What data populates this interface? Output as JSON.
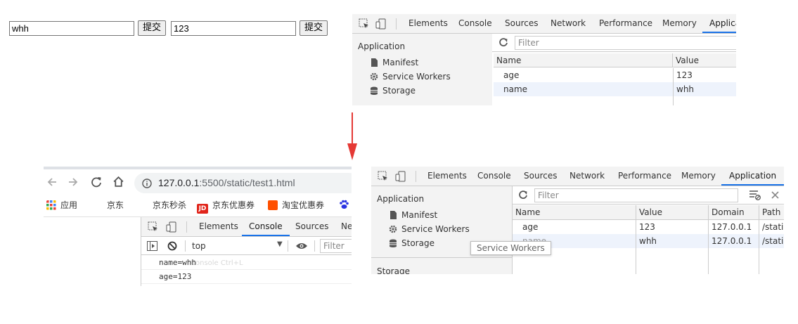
{
  "form": {
    "input1_value": "whh",
    "submit1_label": "提交",
    "input2_value": "123",
    "submit2_label": "提交"
  },
  "devtools_top": {
    "tabs": [
      "Elements",
      "Console",
      "Sources",
      "Network",
      "Performance",
      "Memory",
      "Applica"
    ],
    "active_tab": "Applica",
    "sidebar_title": "Application",
    "sidebar_items": [
      "Manifest",
      "Service Workers",
      "Storage"
    ],
    "filter_placeholder": "Filter",
    "columns": [
      "Name",
      "Value"
    ],
    "rows": [
      {
        "name": "age",
        "value": "123"
      },
      {
        "name": "name",
        "value": "whh"
      }
    ]
  },
  "browser": {
    "url_host": "127.0.0.1",
    "url_path": ":5500/static/test1.html",
    "bookmarks": [
      "应用",
      "京东",
      "京东秒杀",
      "京东优惠券",
      "淘宝优惠券"
    ],
    "devtools_tabs": [
      "Elements",
      "Console",
      "Sources",
      "Ne"
    ],
    "active_tab": "Console",
    "context": "top",
    "filter_placeholder": "Filter",
    "console_lines": [
      "name=whh",
      "age=123"
    ],
    "ghost_hint": "Console  Ctrl+L"
  },
  "devtools_bottom": {
    "tabs": [
      "Elements",
      "Console",
      "Sources",
      "Network",
      "Performance",
      "Memory",
      "Application"
    ],
    "active_tab": "Application",
    "sidebar_title": "Application",
    "sidebar_items": [
      "Manifest",
      "Service Workers",
      "Storage"
    ],
    "sidebar_section2": "Storage",
    "filter_placeholder": "Filter",
    "columns": [
      "Name",
      "Value",
      "Domain",
      "Path"
    ],
    "rows": [
      {
        "name": "age",
        "value": "123",
        "domain": "127.0.0.1",
        "path": "/static"
      },
      {
        "name": "name",
        "value": "whh",
        "domain": "127.0.0.1",
        "path": "/static"
      }
    ],
    "tooltip": "Service Workers"
  },
  "colors": {
    "accent": "#1a73e8",
    "arrow": "#e53935",
    "selected_row": "#eef3fc"
  }
}
